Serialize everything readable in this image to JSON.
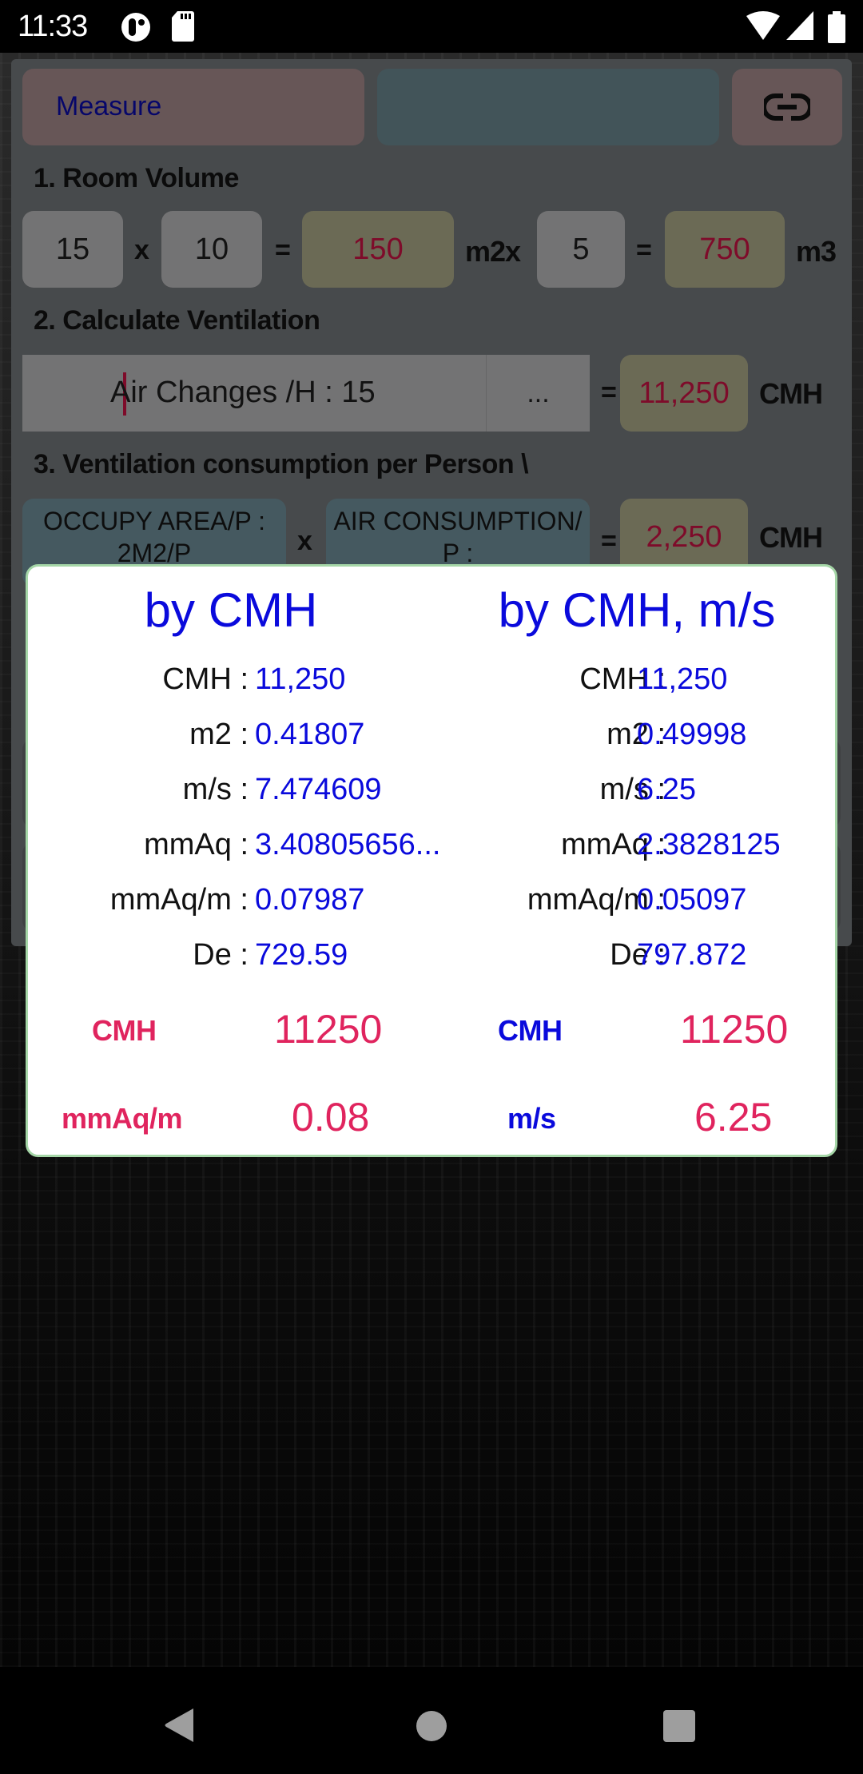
{
  "status_bar": {
    "time": "11:33",
    "left_icons": [
      "notification-app-icon",
      "sd-card-icon"
    ],
    "right_icons": [
      "wifi-icon",
      "cell-signal-icon",
      "battery-icon"
    ]
  },
  "toolbar": {
    "measure_label": "Measure",
    "middle_button_label": "",
    "link_icon": "link-icon"
  },
  "section1": {
    "title": "1. Room Volume",
    "length": "15",
    "op1": "x",
    "width": "10",
    "eq1": "=",
    "area": "150",
    "area_unit": "m2x",
    "height": "5",
    "eq2": "=",
    "volume": "750",
    "volume_unit": "m3"
  },
  "section2": {
    "title": "2. Calculate Ventilation",
    "air_changes_input": "Air Changes /H : 15",
    "more_button": "...",
    "eq": "=",
    "result": "11,250",
    "unit": "CMH"
  },
  "section3": {
    "title": "3. Ventilation consumption per Person \\",
    "occupy_area": "OCCUPY AREA/P : 2M2/P",
    "op": "x",
    "air_consumption": "AIR CONSUMPTION/ P :",
    "eq": "=",
    "result": "2,250",
    "unit": "CMH"
  },
  "dialog": {
    "left": {
      "title": "by CMH",
      "rows": [
        {
          "label": "CMH :",
          "value": "11,250"
        },
        {
          "label": "m2 :",
          "value": "0.41807"
        },
        {
          "label": "m/s :",
          "value": "7.474609"
        },
        {
          "label": "mmAq :",
          "value": "3.40805656..."
        },
        {
          "label": "mmAq/m :",
          "value": "0.07987"
        },
        {
          "label": "De :",
          "value": "729.59"
        }
      ],
      "summary": [
        {
          "label": "CMH",
          "value": "11250"
        },
        {
          "label": "mmAq/m",
          "value": "0.08"
        }
      ]
    },
    "right": {
      "title": "by CMH, m/s",
      "rows": [
        {
          "label": "CMH :",
          "value": "11,250"
        },
        {
          "label": "m2 :",
          "value": "0.49998"
        },
        {
          "label": "m/s :",
          "value": "6.25"
        },
        {
          "label": "mmAq :",
          "value": "2.3828125"
        },
        {
          "label": "mmAq/m :",
          "value": "0.05097"
        },
        {
          "label": "De :",
          "value": "797.872"
        }
      ],
      "summary": [
        {
          "label": "CMH",
          "value": "11250"
        },
        {
          "label": "m/s",
          "value": "6.25"
        }
      ]
    }
  },
  "colors": {
    "title_blue": "#0a0adc",
    "value_pink": "#e0245e",
    "result_red": "#7e0b2a",
    "dialog_border": "#a5d6a7"
  },
  "nav_bar": {
    "buttons": [
      "back",
      "home",
      "recents"
    ]
  }
}
